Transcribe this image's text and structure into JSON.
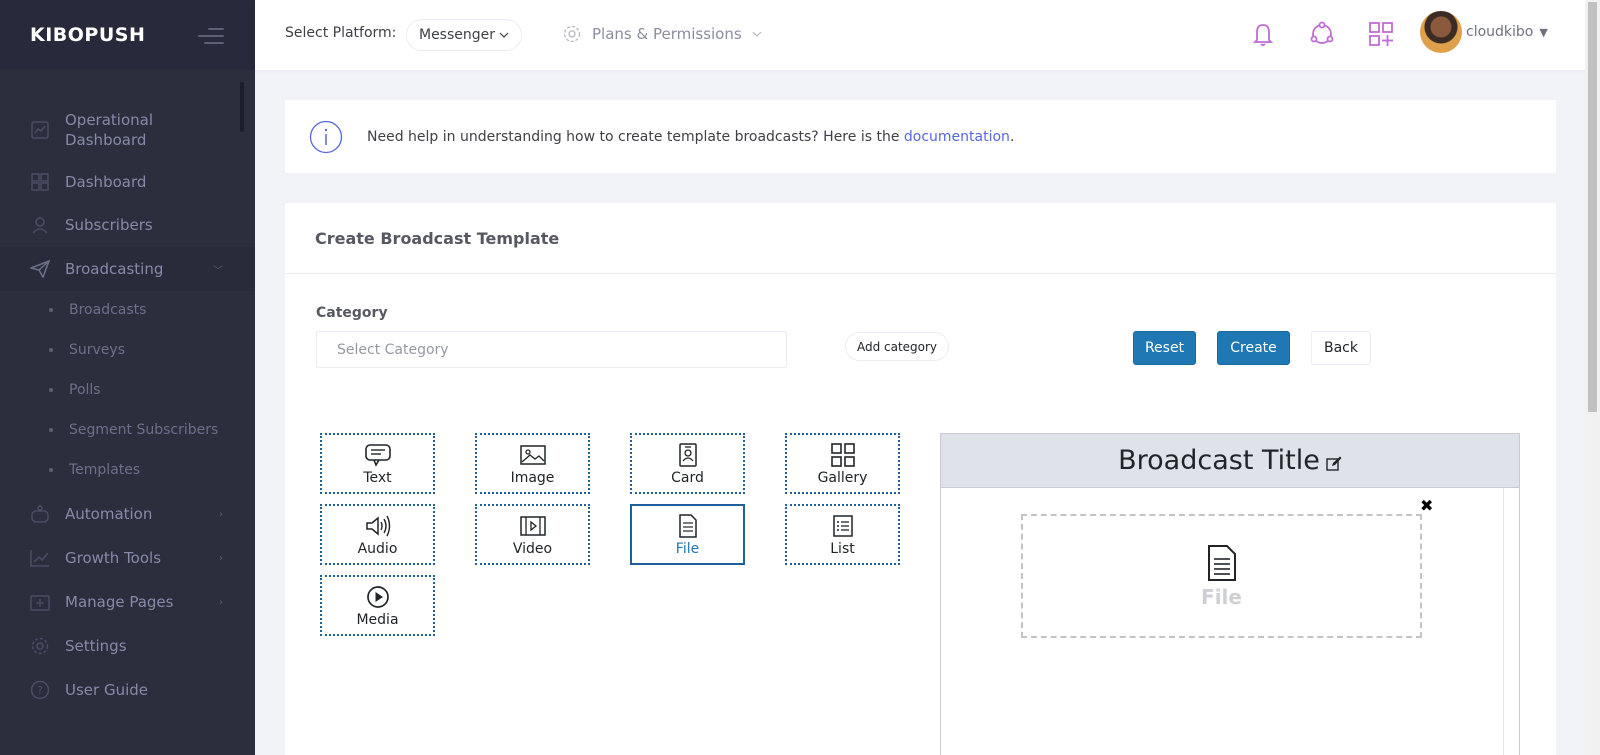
{
  "brand": "KIBOPUSH",
  "sidebar": {
    "items": [
      {
        "label": "Operational Dashboard",
        "icon": "dashboard-chart-icon"
      },
      {
        "label": "Dashboard",
        "icon": "grid-icon"
      },
      {
        "label": "Subscribers",
        "icon": "user-icon"
      },
      {
        "label": "Broadcasting",
        "icon": "send-icon"
      },
      {
        "label": "Automation",
        "icon": "robot-icon"
      },
      {
        "label": "Growth Tools",
        "icon": "growth-chart-icon"
      },
      {
        "label": "Manage Pages",
        "icon": "pages-icon"
      },
      {
        "label": "Settings",
        "icon": "gear-icon"
      },
      {
        "label": "User Guide",
        "icon": "question-icon"
      }
    ],
    "subitems": [
      "Broadcasts",
      "Surveys",
      "Polls",
      "Segment Subscribers",
      "Templates"
    ]
  },
  "header": {
    "platform_label": "Select Platform:",
    "platform_value": "Messenger",
    "plans_label": "Plans & Permissions",
    "username": "cloudkibo"
  },
  "info": {
    "text": "Need help in understanding how to create template broadcasts? Here is the ",
    "link": "documentation",
    "end": "."
  },
  "page": {
    "title": "Create Broadcast Template",
    "category_label": "Category",
    "category_placeholder": "Select Category",
    "add_category": "Add category",
    "reset": "Reset",
    "create": "Create",
    "back": "Back"
  },
  "components": [
    "Text",
    "Image",
    "Card",
    "Gallery",
    "Audio",
    "Video",
    "File",
    "List",
    "Media"
  ],
  "selected_component": "File",
  "preview": {
    "title": "Broadcast Title",
    "close": "✖",
    "file_label": "File"
  },
  "colors": {
    "sidebar_bg": "#2c2e3e",
    "primary": "#1f78b4",
    "link": "#5867dd",
    "accent_icons": "#c06bd6"
  }
}
